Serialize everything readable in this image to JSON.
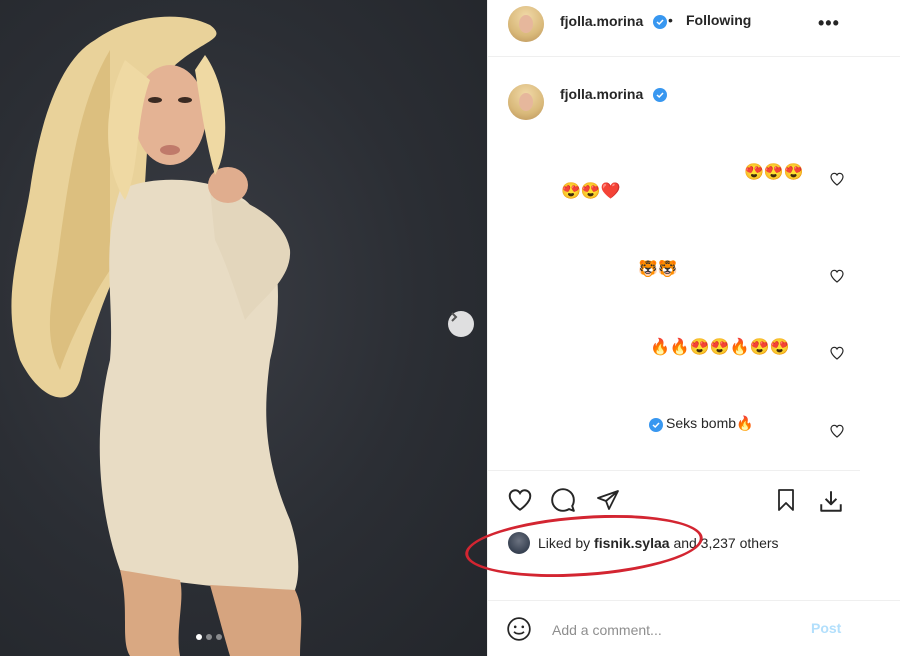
{
  "post": {
    "username": "fjolla.morina",
    "follow_status": "Following",
    "more_label": "•••",
    "separator": "•",
    "caption_username": "fjolla.morina",
    "comments": [
      {
        "text": "😍😍😍"
      },
      {
        "text": "😍😍❤️"
      },
      {
        "text": "🐯🐯"
      },
      {
        "text": "🔥🔥😍😍🔥😍😍"
      },
      {
        "text": "Seks bomb🔥"
      }
    ],
    "likes": {
      "prefix": "Liked by",
      "user": "fisnik.sylaa",
      "suffix": "and 3,237 others"
    },
    "comment_box": {
      "placeholder": "Add a comment...",
      "post_label": "Post"
    },
    "carousel": {
      "count": 3,
      "active_index": 0
    }
  },
  "colors": {
    "verified": "#3897f0",
    "annotation_ring": "#d32531",
    "post_button_disabled": "#b2dffc"
  }
}
